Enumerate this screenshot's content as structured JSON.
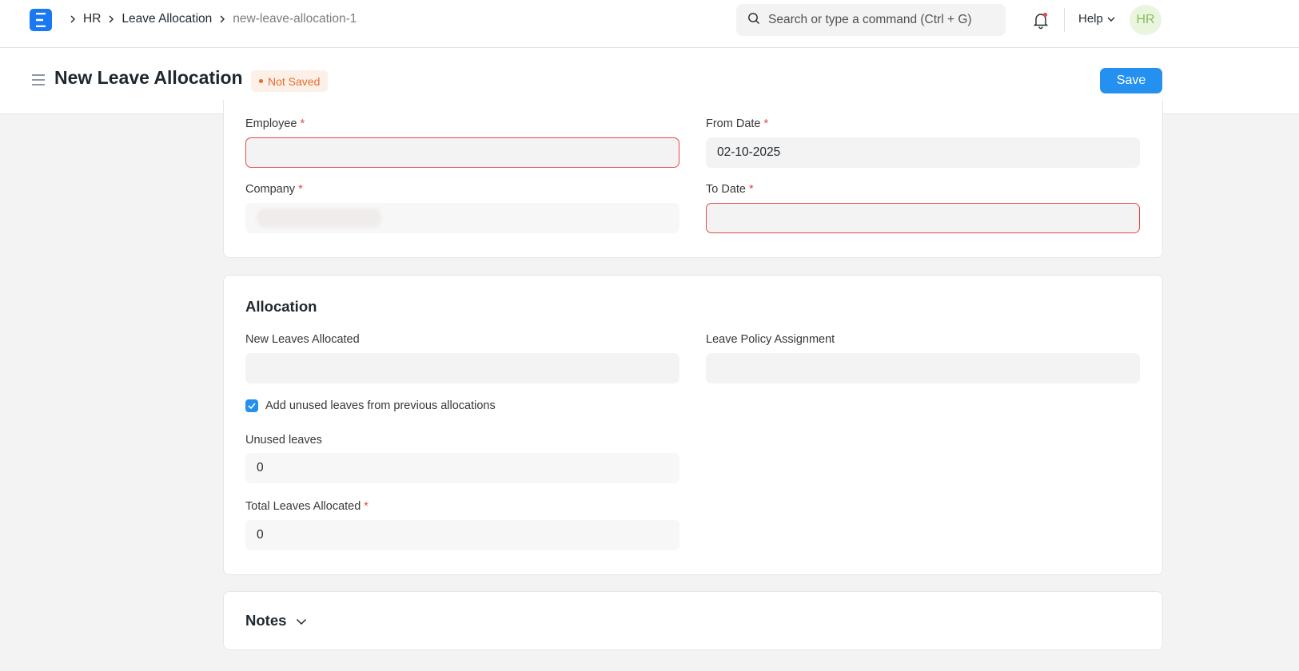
{
  "navbar": {
    "breadcrumbs": [
      "HR",
      "Leave Allocation",
      "new-leave-allocation-1"
    ],
    "search_placeholder": "Search or type a command (Ctrl + G)",
    "help_label": "Help",
    "avatar_initials": "HR"
  },
  "page": {
    "title": "New Leave Allocation",
    "status": "Not Saved",
    "save_label": "Save"
  },
  "details": {
    "employee_label": "Employee",
    "employee_value": "",
    "from_date_label": "From Date",
    "from_date_value": "02-10-2025",
    "company_label": "Company",
    "to_date_label": "To Date",
    "to_date_value": ""
  },
  "allocation": {
    "title": "Allocation",
    "new_leaves_label": "New Leaves Allocated",
    "new_leaves_value": "",
    "policy_label": "Leave Policy Assignment",
    "policy_value": "",
    "carry_forward_label": "Add unused leaves from previous allocations",
    "unused_label": "Unused leaves",
    "unused_value": "0",
    "total_label": "Total Leaves Allocated",
    "total_value": "0"
  },
  "notes": {
    "title": "Notes"
  },
  "colors": {
    "primary": "#2490ef",
    "error": "#e24c4c",
    "status": "#e86c2c"
  }
}
